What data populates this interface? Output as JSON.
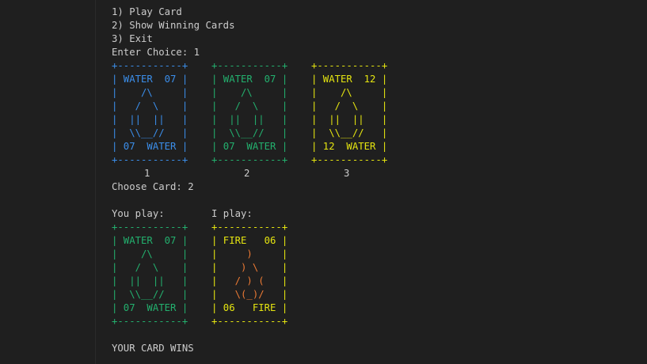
{
  "colors": {
    "background": "#1f1f1f",
    "text": "#cccccc",
    "blue": "#3b8eea",
    "green": "#23b06e",
    "yellow": "#e5e510",
    "orange": "#ec7a34"
  },
  "terminal": {
    "menu": [
      "1) Play Card",
      "2) Show Winning Cards",
      "3) Exit"
    ],
    "prompt_choice": "Enter Choice: 1",
    "choose_card": "Choose Card: 2",
    "you_play": "You play:",
    "i_play": "I play:",
    "result": "YOUR CARD WINS"
  },
  "hand": [
    {
      "label": "1",
      "color": "blue",
      "lines": [
        "+-----------+",
        "| WATER  07 |",
        "|    /\\     |",
        "|   /  \\    |",
        "|  ||  ||   |",
        "|  \\\\__//   |",
        "| 07  WATER |",
        "+-----------+"
      ]
    },
    {
      "label": "2",
      "color": "green",
      "lines": [
        "+-----------+",
        "| WATER  07 |",
        "|    /\\     |",
        "|   /  \\    |",
        "|  ||  ||   |",
        "|  \\\\__//   |",
        "| 07  WATER |",
        "+-----------+"
      ]
    },
    {
      "label": "3",
      "color": "yellow",
      "lines": [
        "+-----------+",
        "| WATER  12 |",
        "|    /\\     |",
        "|   /  \\    |",
        "|  ||  ||   |",
        "|  \\\\__//   |",
        "| 12  WATER |",
        "+-----------+"
      ]
    }
  ],
  "played": {
    "you": {
      "color": "green",
      "lines": [
        "+-----------+",
        "| WATER  07 |",
        "|    /\\     |",
        "|   /  \\    |",
        "|  ||  ||   |",
        "|  \\\\__//   |",
        "| 07  WATER |",
        "+-----------+"
      ]
    },
    "me": {
      "color": "yellow",
      "lines": [
        "+-----------+",
        "| FIRE   06 |",
        "|     )     |",
        "|    ) \\    |",
        "|   / ) (   |",
        "|   \\(_)/   |",
        "| 06   FIRE |",
        "+-----------+"
      ],
      "art_color": "orange",
      "art_rows": [
        2,
        3,
        4,
        5
      ]
    }
  }
}
